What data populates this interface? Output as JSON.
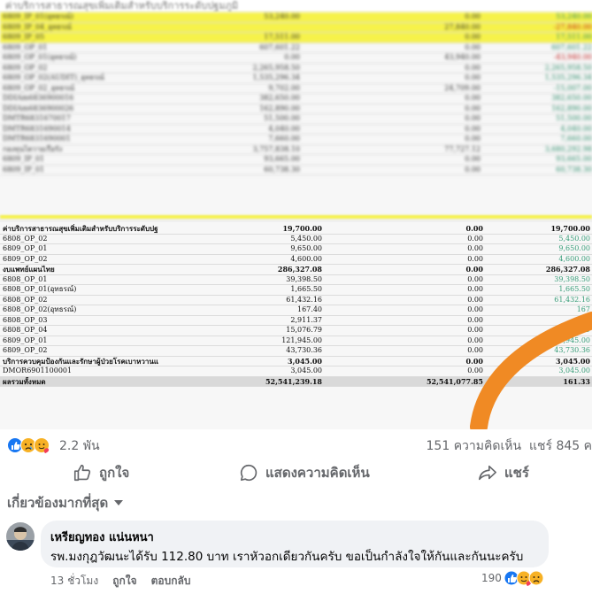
{
  "top_caption_blurred": "ค่าบริการสาธารณสุขเพิ่มเติมสำหรับบริการระดับปฐมภูมิ",
  "blurred_rows": [
    {
      "c1": "6809_IP_01(อุทธรณ์)",
      "c2": "53,240.00",
      "c3": "0.00",
      "c4": "53,240.00",
      "hl": true,
      "red": false
    },
    {
      "c1": "6809_IP_04_อุทธรณ์",
      "c2": "",
      "c3": "27,840.00",
      "c4": "-27,840.00",
      "hl": true,
      "red": true
    },
    {
      "c1": "6809_IP_05",
      "c2": "17,511.00",
      "c3": "0.00",
      "c4": "17,511.00",
      "hl": true,
      "red": false
    },
    {
      "c1": "6809_OP_01",
      "c2": "607,601.22",
      "c3": "0.00",
      "c4": "607,601.22",
      "hl": false,
      "red": false
    },
    {
      "c1": "6809_OP_01(อุทธรณ์)",
      "c2": "0.00",
      "c3": "43,940.00",
      "c4": "-43,940.00",
      "hl": false,
      "red": true
    },
    {
      "c1": "6809_OP_02",
      "c2": "2,265,958.50",
      "c3": "0.00",
      "c4": "2,265,958.50",
      "hl": false,
      "red": false
    },
    {
      "c1": "6809_OP_02(AUDIT)_อุทธรณ์",
      "c2": "1,535,296.34",
      "c3": "0.00",
      "c4": "1,535,296.34",
      "hl": false,
      "red": false
    },
    {
      "c1": "6809_OP_02_อุทธรณ์",
      "c2": "9,702.00",
      "c3": "24,709.00",
      "c4": "-15,007.00",
      "hl": false,
      "red": false
    },
    {
      "c1": "DDIAm6836900016",
      "c2": "382,650.00",
      "c3": "0.00",
      "c4": "382,650.00",
      "hl": false,
      "red": false
    },
    {
      "c1": "DDIAm6836900026",
      "c2": "162,890.00",
      "c3": "0.00",
      "c4": "162,890.00",
      "hl": false,
      "red": false
    },
    {
      "c1": "DMTR6831670017",
      "c2": "51,500.00",
      "c3": "0.00",
      "c4": "51,500.00",
      "hl": false,
      "red": false
    },
    {
      "c1": "DMTR6831690014",
      "c2": "4,040.00",
      "c3": "0.00",
      "c4": "4,040.00",
      "hl": false,
      "red": false
    },
    {
      "c1": "DMTR6831690001",
      "c2": "7,660.00",
      "c3": "0.00",
      "c4": "7,660.00",
      "hl": false,
      "red": false
    },
    {
      "c1": "กองทุนไตวายเรื้อรัง",
      "c2": "3,757,838.10",
      "c3": "77,727.12",
      "c4": "3,680,292.98",
      "hl": false,
      "red": false
    },
    {
      "c1": "6809_IP_01",
      "c2": "93,665.00",
      "c3": "0.00",
      "c4": "93,665.00",
      "hl": false,
      "red": false
    },
    {
      "c1": "6809_IP_01",
      "c2": "60,738.30",
      "c3": "0.00",
      "c4": "60,738.30",
      "hl": false,
      "red": false
    }
  ],
  "table_rows": [
    {
      "c1": "ค่าบริการสาธารณสุขเพิ่มเติมสำหรับบริการระดับปฐ",
      "c2": "19,700.00",
      "c3": "0.00",
      "c4": "19,700.00",
      "type": "bold"
    },
    {
      "c1": "6808_OP_02",
      "c2": "5,450.00",
      "c3": "0.00",
      "c4": "5,450.00",
      "type": ""
    },
    {
      "c1": "6809_OP_01",
      "c2": "9,650.00",
      "c3": "0.00",
      "c4": "9,650.00",
      "type": ""
    },
    {
      "c1": "6809_OP_02",
      "c2": "4,600.00",
      "c3": "0.00",
      "c4": "4,600.00",
      "type": ""
    },
    {
      "c1": "งบแพทย์แผนไทย",
      "c2": "286,327.08",
      "c3": "0.00",
      "c4": "286,327.08",
      "type": "bold"
    },
    {
      "c1": "6808_OP_01",
      "c2": "39,398.50",
      "c3": "0.00",
      "c4": "39,398.50",
      "type": ""
    },
    {
      "c1": "6808_OP_01(อุทธรณ์)",
      "c2": "1,665.50",
      "c3": "0.00",
      "c4": "1,665.50",
      "type": ""
    },
    {
      "c1": "6808_OP_02",
      "c2": "61,432.16",
      "c3": "0.00",
      "c4": "61,432.16",
      "type": ""
    },
    {
      "c1": "6808_OP_02(อุทธรณ์)",
      "c2": "167.40",
      "c3": "0.00",
      "c4": "167",
      "type": ""
    },
    {
      "c1": "6808_OP_03",
      "c2": "2,911.37",
      "c3": "0.00",
      "c4": "",
      "type": ""
    },
    {
      "c1": "6808_OP_04",
      "c2": "15,076.79",
      "c3": "0.00",
      "c4": "076.79",
      "type": ""
    },
    {
      "c1": "6809_OP_01",
      "c2": "121,945.00",
      "c3": "0.00",
      "c4": "121,945.00",
      "type": ""
    },
    {
      "c1": "6809_OP_02",
      "c2": "43,730.36",
      "c3": "0.00",
      "c4": "43,730.36",
      "type": ""
    },
    {
      "c1": "บริการควบคุมป้องกันและรักษาผู้ป่วยโรคเบาหวานแ",
      "c2": "3,045.00",
      "c3": "0.00",
      "c4": "3,045.00",
      "type": "bold"
    },
    {
      "c1": "DMOR6901100001",
      "c2": "3,045.00",
      "c3": "0.00",
      "c4": "3,045.00",
      "type": ""
    },
    {
      "c1": "ผลรวมทั้งหมด",
      "c2": "52,541,239.18",
      "c3": "52,541,077.85",
      "c4": "161.33",
      "type": "total"
    }
  ],
  "stats": {
    "reactions_count": "2.2 พัน",
    "comments_count": "151 ความคิดเห็น",
    "shares_count": "แชร์ 845 ค"
  },
  "actions": {
    "like": "ถูกใจ",
    "comment": "แสดงความคิดเห็น",
    "share": "แชร์"
  },
  "filter_label": "เกี่ยวข้องมากที่สุด",
  "comment": {
    "author": "เหรียญทอง แน่นหนา",
    "text": "รพ.มงกุฎวัฒนะได้รับ 112.80 บาท เราหัวอกเดียวกันครับ ขอเป็นกำลังใจให้กันและกันนะครับ",
    "time": "13 ชั่วโมง",
    "like": "ถูกใจ",
    "reply": "ตอบกลับ",
    "reaction_count": "190"
  },
  "colors": {
    "highlight_yellow": "#f6f24a",
    "positive_green": "#3a9e7a",
    "orange_annotation": "#f08a24",
    "fb_blue": "#1877f2",
    "muted_text": "#65676b"
  }
}
